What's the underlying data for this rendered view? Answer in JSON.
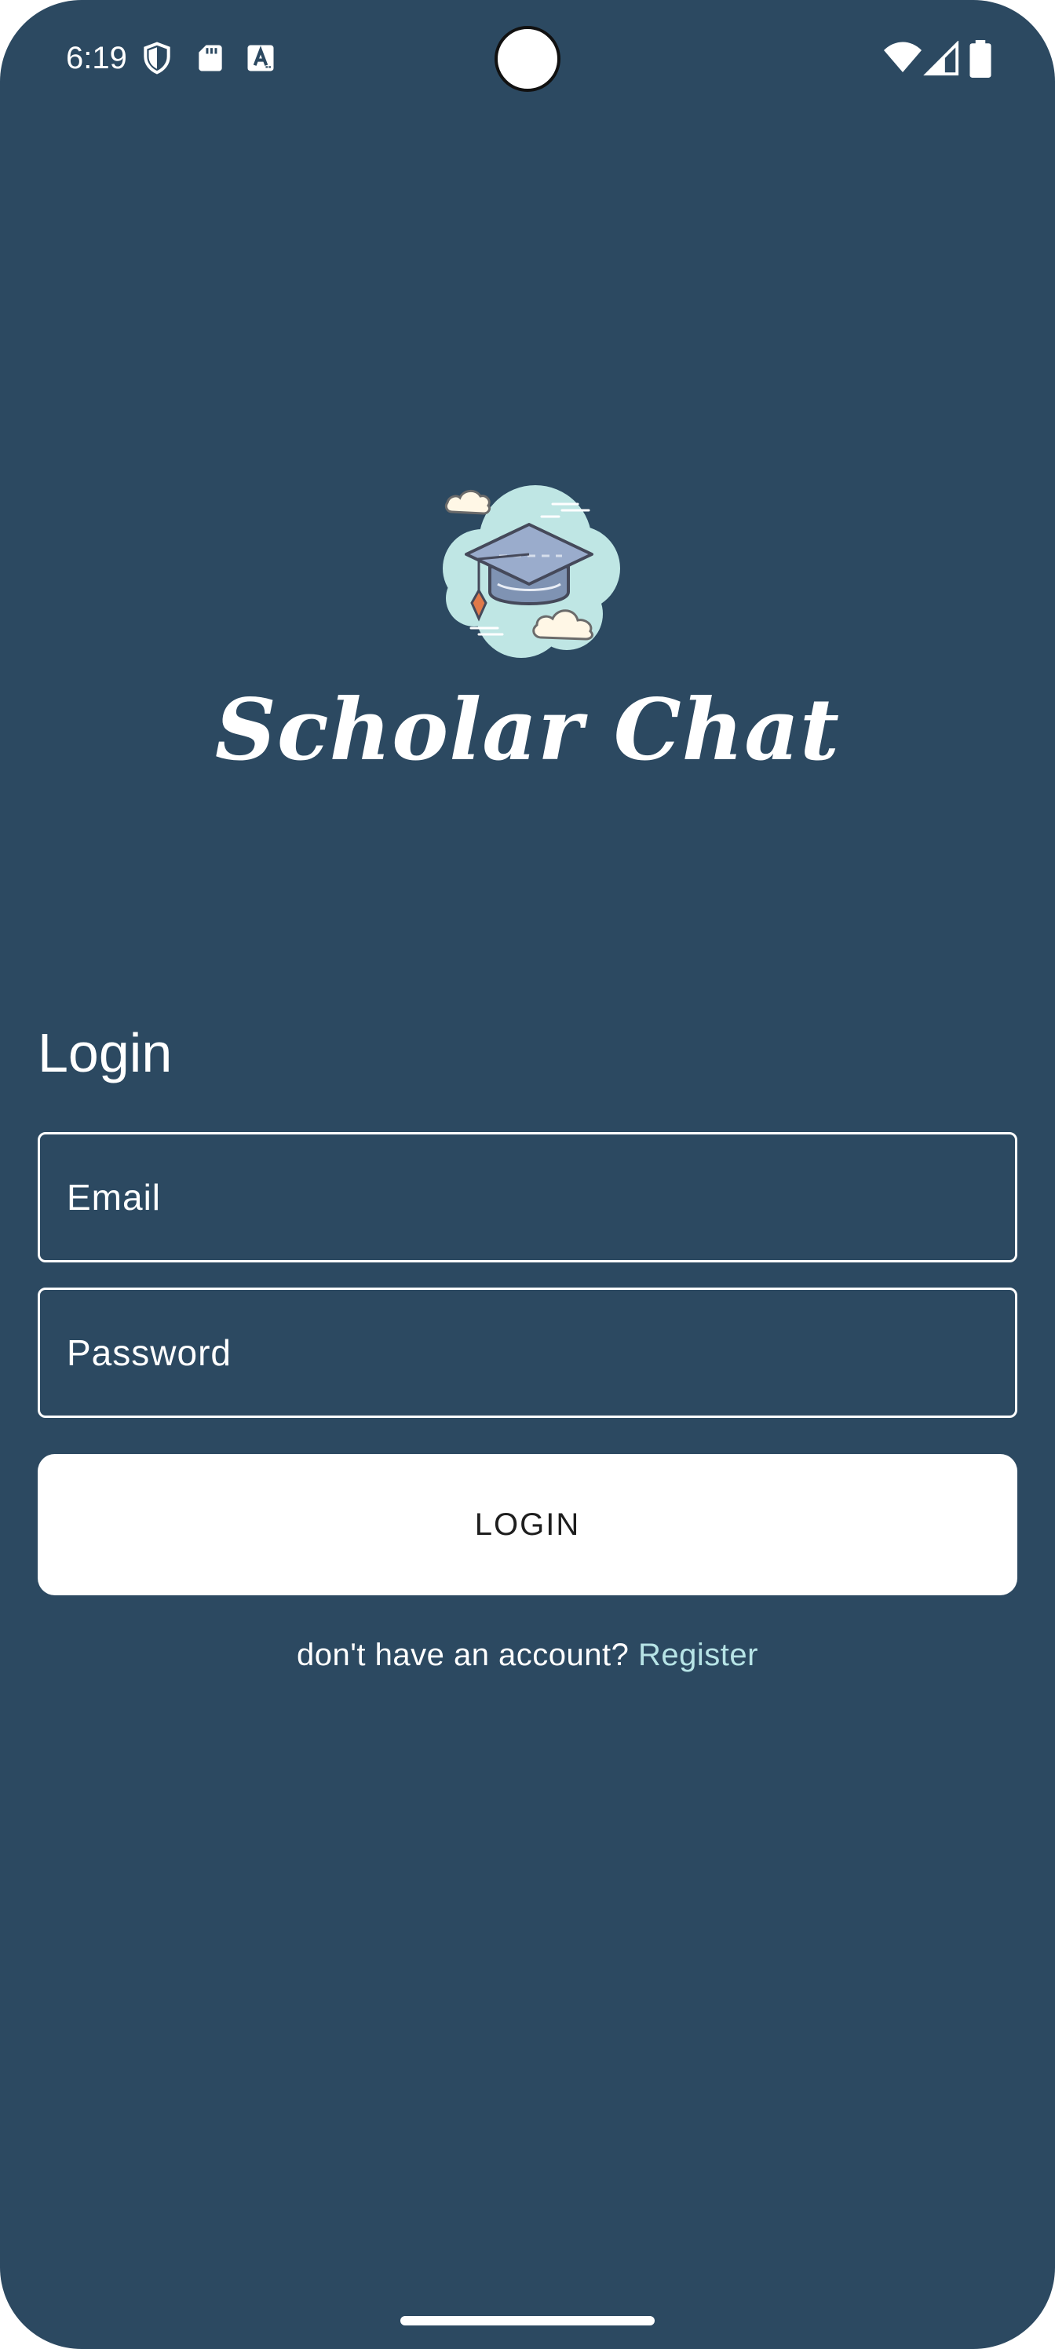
{
  "status_bar": {
    "time": "6:19",
    "left_icons": [
      "shield-icon",
      "sd-card-icon",
      "keyboard-a-icon"
    ],
    "right_icons": [
      "wifi-icon",
      "cell-signal-icon",
      "battery-icon"
    ]
  },
  "app": {
    "title": "Scholar Chat",
    "logo_icon": "graduation-cap-cloud-icon"
  },
  "login_form": {
    "heading": "Login",
    "email_placeholder": "Email",
    "email_value": "",
    "password_placeholder": "Password",
    "password_value": "",
    "login_button_label": "LOGIN",
    "register_prompt": "don't have an account?",
    "register_link": "Register"
  },
  "colors": {
    "background": "#2c4961",
    "accent_link": "#b7e4e6",
    "button_bg": "#ffffff",
    "logo_cloud": "#bfe6e4",
    "logo_cap": "#8fa6c6"
  }
}
